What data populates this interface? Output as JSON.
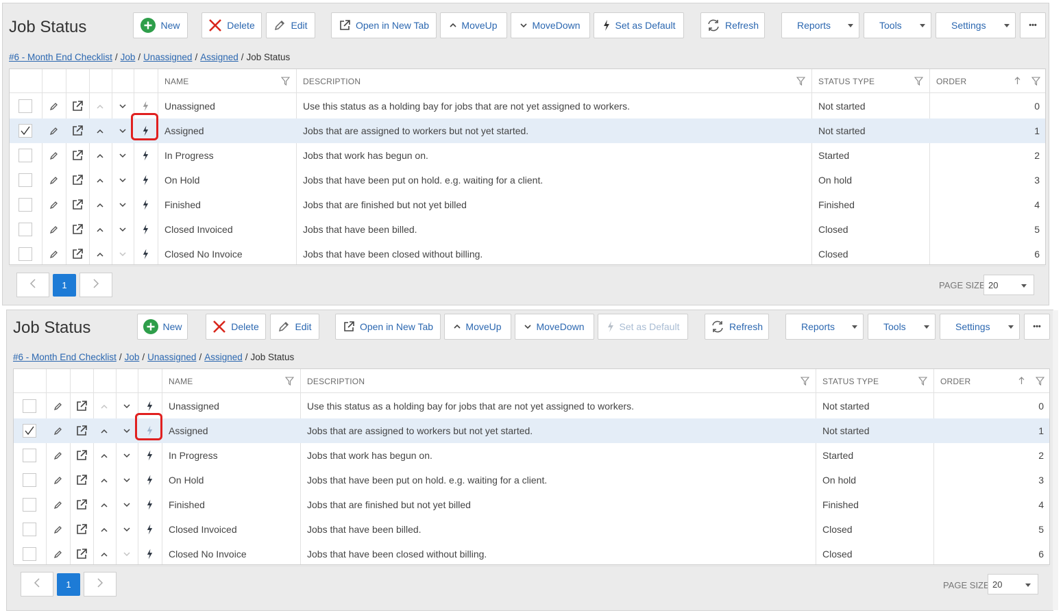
{
  "title": "Job Status",
  "toolbar": {
    "new_label": "New",
    "delete_label": "Delete",
    "edit_label": "Edit",
    "open_new_tab_label": "Open in New Tab",
    "moveup_label": "MoveUp",
    "movedown_label": "MoveDown",
    "set_default_label": "Set as Default",
    "refresh_label": "Refresh",
    "reports_label": "Reports",
    "tools_label": "Tools",
    "settings_label": "Settings",
    "more_label": "•••"
  },
  "breadcrumb": {
    "items": [
      "#6 - Month End Checklist",
      "Job",
      "Unassigned",
      "Assigned"
    ],
    "current": "Job Status",
    "separator": "/"
  },
  "columns": {
    "name": "NAME",
    "description": "DESCRIPTION",
    "status_type": "STATUS TYPE",
    "order": "ORDER"
  },
  "rows": [
    {
      "name": "Unassigned",
      "description": "Use this status as a holding bay for jobs that are not yet assigned to workers.",
      "status_type": "Not started",
      "order": "0"
    },
    {
      "name": "Assigned",
      "description": "Jobs that are assigned to workers but not yet started.",
      "status_type": "Not started",
      "order": "1"
    },
    {
      "name": "In Progress",
      "description": "Jobs that work has begun on.",
      "status_type": "Started",
      "order": "2"
    },
    {
      "name": "On Hold",
      "description": "Jobs that have been put on hold. e.g. waiting for a client.",
      "status_type": "On hold",
      "order": "3"
    },
    {
      "name": "Finished",
      "description": "Jobs that are finished but not yet billed",
      "status_type": "Finished",
      "order": "4"
    },
    {
      "name": "Closed Invoiced",
      "description": "Jobs that have been billed.",
      "status_type": "Closed",
      "order": "5"
    },
    {
      "name": "Closed No Invoice",
      "description": "Jobs that have been closed without billing.",
      "status_type": "Closed",
      "order": "6"
    }
  ],
  "pager": {
    "current_page": "1",
    "page_size_label": "PAGE SIZE",
    "page_size": "20"
  },
  "panels": [
    {
      "selected_row": 1,
      "default_row": 0,
      "set_default_enabled": true
    },
    {
      "selected_row": 1,
      "default_row": 1,
      "set_default_enabled": false
    }
  ],
  "colors": {
    "accent": "#2b67b0",
    "new_icon": "#2e9e4a",
    "delete_icon": "#d9261c",
    "highlight": "#e02020",
    "selected_row": "#e4edf7",
    "page_active": "#1d7bd6"
  }
}
